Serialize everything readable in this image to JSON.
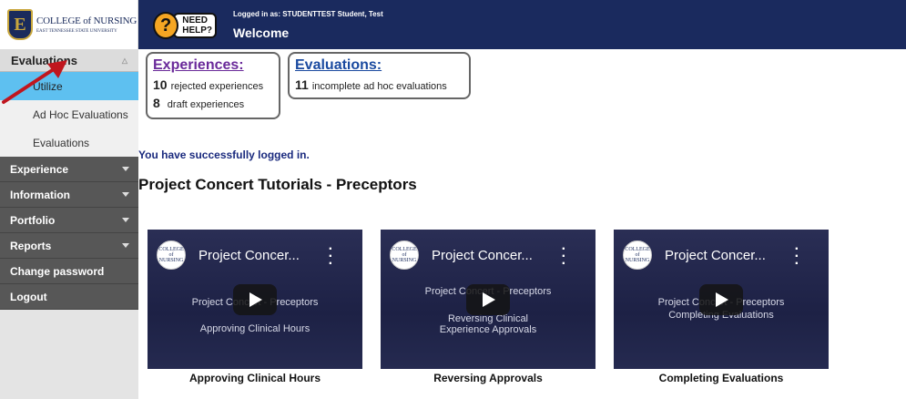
{
  "header": {
    "logo_main": "COLLEGE of NURSING",
    "logo_sub": "EAST TENNESSEE STATE UNIVERSITY",
    "logo_letter": "E",
    "help_icon_text": "?",
    "help_label_1": "NEED",
    "help_label_2": "HELP?",
    "login_info": "Logged in as: STUDENTTEST Student, Test",
    "welcome": "Welcome"
  },
  "sidebar": {
    "active_section": "Evaluations",
    "sub_items": [
      "Utilize",
      "Ad Hoc Evaluations",
      "Evaluations"
    ],
    "items": [
      {
        "label": "Experience",
        "has_menu": true
      },
      {
        "label": "Information",
        "has_menu": true
      },
      {
        "label": "Portfolio",
        "has_menu": true
      },
      {
        "label": "Reports",
        "has_menu": true
      },
      {
        "label": "Change password",
        "has_menu": false
      },
      {
        "label": "Logout",
        "has_menu": false
      }
    ]
  },
  "summary": {
    "experiences": {
      "title": "Experiences:",
      "lines": [
        {
          "count": "10",
          "text": "rejected experiences"
        },
        {
          "count": "8",
          "text": "draft experiences"
        }
      ]
    },
    "evaluations": {
      "title": "Evaluations:",
      "lines": [
        {
          "count": "11",
          "text": "incomplete ad hoc evaluations"
        }
      ]
    }
  },
  "main": {
    "success_message": "You have successfully logged in.",
    "section_title": "Project Concert Tutorials - Preceptors"
  },
  "videos": [
    {
      "title": "Project Concer...",
      "line1": "Project Concert - Preceptors",
      "line2": "Approving Clinical Hours",
      "caption": "Approving Clinical Hours"
    },
    {
      "title": "Project Concer...",
      "line1": "Project Concert - Preceptors",
      "line2": "Reversing Clinical Experience Approvals",
      "caption": "Reversing Approvals"
    },
    {
      "title": "Project Concer...",
      "line1": "Project Concert - Preceptors",
      "line2": "Completing Evaluations",
      "caption": "Completing Evaluations"
    }
  ],
  "video_logo_text": "COLLEGE of NURSING",
  "colors": {
    "topbar": "#1a2a5e",
    "sidebar_dark": "#575757",
    "selected": "#5ec0f0",
    "experiences_link": "#6a2a9a",
    "evaluations_link": "#1a4aa0",
    "arrow": "#c0161e"
  }
}
